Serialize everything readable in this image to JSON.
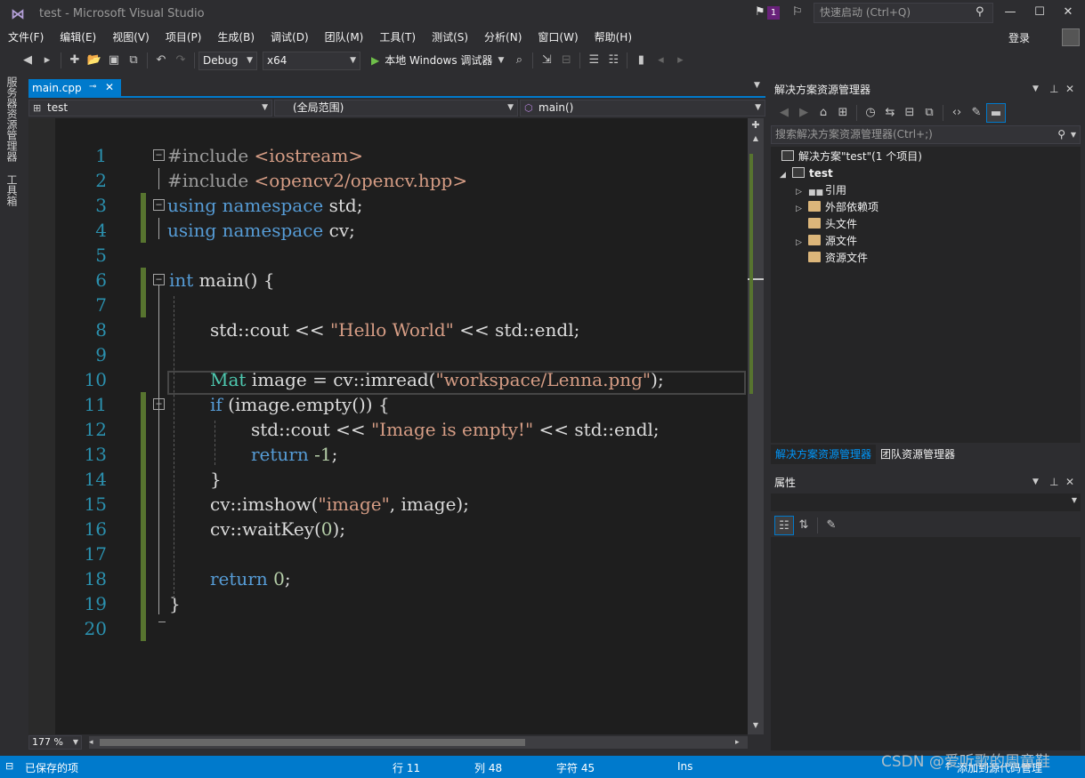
{
  "window": {
    "title": "test - Microsoft Visual Studio",
    "notification_count": "1",
    "quick_launch_placeholder": "快速启动 (Ctrl+Q)",
    "login": "登录"
  },
  "menu": [
    "文件(F)",
    "编辑(E)",
    "视图(V)",
    "项目(P)",
    "生成(B)",
    "调试(D)",
    "团队(M)",
    "工具(T)",
    "测试(S)",
    "分析(N)",
    "窗口(W)",
    "帮助(H)"
  ],
  "toolbar": {
    "config": "Debug",
    "platform": "x64",
    "run_label": "本地 Windows 调试器"
  },
  "left_tabs": [
    "服务器资源管理器",
    "工具箱"
  ],
  "editor": {
    "tab_name": "main.cpp",
    "nav_project": "test",
    "nav_scope": "(全局范围)",
    "nav_member": "main()",
    "zoom": "177 %"
  },
  "code": {
    "l2_inc": "#include ",
    "l2_file": "<iostream>",
    "l3_inc": "#include ",
    "l3_file": "<opencv2/opencv.hpp>",
    "l4_kw1": "using",
    "l4_kw2": "namespace",
    "l4_rest": " std;",
    "l5_kw1": "using",
    "l5_kw2": "namespace",
    "l5_rest": " cv;",
    "l7_kw": "int",
    "l7_rest": " main() {",
    "l9_a": "std::cout << ",
    "l9_str": "\"Hello World\"",
    "l9_b": " << std::endl;",
    "l11_type": "Mat",
    "l11_a": " image = cv::imread(",
    "l11_str": "\"workspace/Lenna.png\"",
    "l11_b": ");",
    "l12_kw": "if",
    "l12_rest": " (image.empty()) {",
    "l13_a": "std::cout << ",
    "l13_str": "\"Image is empty!\"",
    "l13_b": " << std::endl;",
    "l14_kw": "return",
    "l14_num": " -1",
    "l14_b": ";",
    "l15": "}",
    "l16_a": "cv::imshow(",
    "l16_str": "\"image\"",
    "l16_b": ", image);",
    "l17_a": "cv::waitKey(",
    "l17_num": "0",
    "l17_b": ");",
    "l19_kw": "return",
    "l19_num": " 0",
    "l19_b": ";",
    "l20": "}"
  },
  "line_numbers": [
    "1",
    "2",
    "3",
    "4",
    "5",
    "6",
    "7",
    "8",
    "9",
    "10",
    "11",
    "12",
    "13",
    "14",
    "15",
    "16",
    "17",
    "18",
    "19",
    "20"
  ],
  "solution_explorer": {
    "title": "解决方案资源管理器",
    "search_placeholder": "搜索解决方案资源管理器(Ctrl+;)",
    "solution": "解决方案\"test\"(1 个项目)",
    "project": "test",
    "items": [
      "引用",
      "外部依赖项",
      "头文件",
      "源文件",
      "资源文件"
    ],
    "tab_solution": "解决方案资源管理器",
    "tab_team": "团队资源管理器"
  },
  "properties": {
    "title": "属性"
  },
  "status": {
    "saved": "已保存的项",
    "line": "行 11",
    "col": "列 48",
    "char": "字符 45",
    "mode": "Ins",
    "source_control": "添加到源代码管理"
  },
  "watermark": "CSDN @爱听歌的周童鞋",
  "colors": {
    "accent": "#007acc",
    "change_bar": "#57742f",
    "keyword": "#569cd6",
    "string": "#d69d85",
    "type": "#4ec9b0",
    "line_number": "#2b91af"
  }
}
